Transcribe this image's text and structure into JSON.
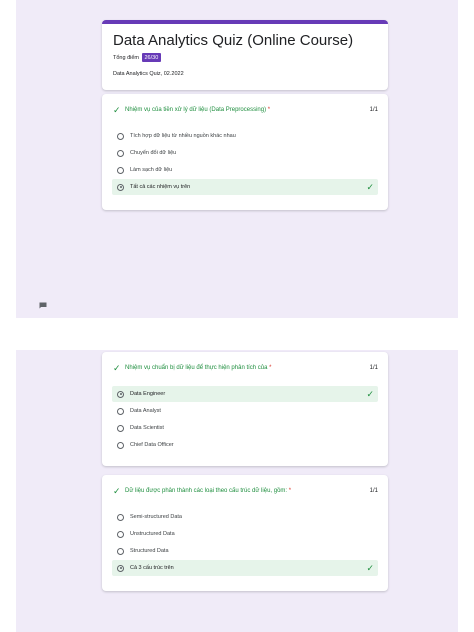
{
  "header": {
    "title": "Data Analytics Quiz  (Online Course)",
    "score_label": "Tổng điểm",
    "score_value": "26/30",
    "subtitle": "Data Analytics Quiz, 02.2022"
  },
  "questions": [
    {
      "text": "Nhiệm vụ của tiền xử lý dữ liệu (Data Preprocessing)",
      "required": "*",
      "score": "1/1",
      "options": [
        {
          "label": "Tích hợp dữ liệu từ nhiều nguồn khác nhau",
          "selected": false,
          "correct": false
        },
        {
          "label": "Chuyển đổi dữ liệu",
          "selected": false,
          "correct": false
        },
        {
          "label": "Làm sạch dữ liệu",
          "selected": false,
          "correct": false
        },
        {
          "label": "Tất cả các nhiệm vụ trên",
          "selected": true,
          "correct": true
        }
      ]
    },
    {
      "text": "Nhiệm vụ chuẩn bị dữ liệu để thực hiện phân tích của",
      "required": "*",
      "score": "1/1",
      "options": [
        {
          "label": "Data Engineer",
          "selected": true,
          "correct": true
        },
        {
          "label": "Data Analyst",
          "selected": false,
          "correct": false
        },
        {
          "label": "Data Scientist",
          "selected": false,
          "correct": false
        },
        {
          "label": "Chief Data Officer",
          "selected": false,
          "correct": false
        }
      ]
    },
    {
      "text": "Dữ liệu được phân thành các loại theo cấu trúc dữ liệu, gồm:",
      "required": "*",
      "score": "1/1",
      "options": [
        {
          "label": "Semi-structured Data",
          "selected": false,
          "correct": false
        },
        {
          "label": "Unstructured Data",
          "selected": false,
          "correct": false
        },
        {
          "label": "Structured Data",
          "selected": false,
          "correct": false
        },
        {
          "label": "Cả 3 cấu trúc trên",
          "selected": true,
          "correct": true
        }
      ]
    }
  ],
  "icons": {
    "correct": "check-icon",
    "feedback": "feedback-icon"
  },
  "colors": {
    "accent": "#673ab7",
    "correct": "#1e8e3e",
    "correct_bg": "#e6f4ea",
    "page_bg": "#f0ebf8"
  }
}
